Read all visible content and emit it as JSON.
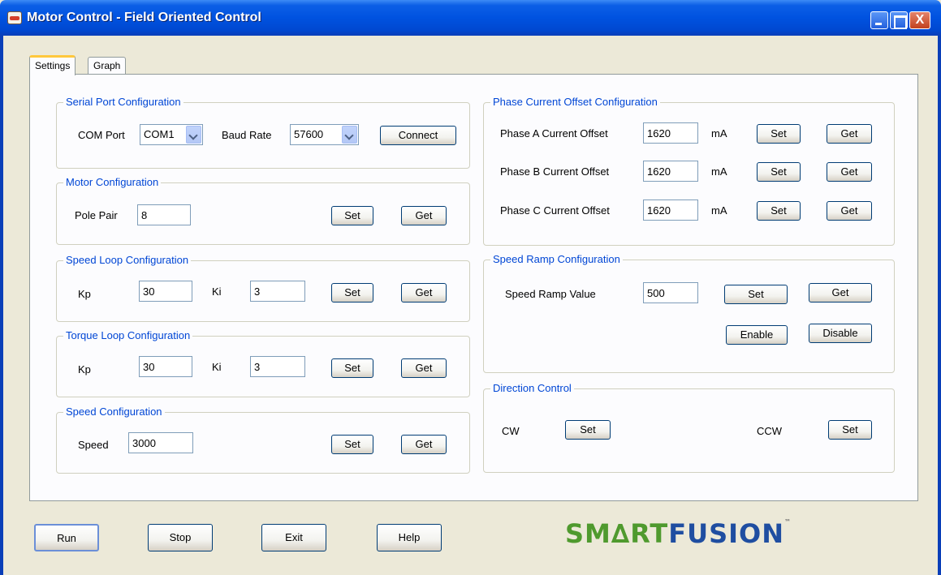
{
  "window": {
    "title": "Motor Control - Field Oriented Control",
    "close_glyph": "X"
  },
  "tabs": [
    {
      "label": "Settings"
    },
    {
      "label": "Graph"
    }
  ],
  "serial": {
    "title": "Serial Port Configuration",
    "com_label": "COM Port",
    "com_value": "COM1",
    "baud_label": "Baud Rate",
    "baud_value": "57600",
    "connect_label": "Connect"
  },
  "motor": {
    "title": "Motor Configuration",
    "pole_label": "Pole Pair",
    "pole_value": "8",
    "set_label": "Set",
    "get_label": "Get"
  },
  "speed_loop": {
    "title": "Speed Loop Configuration",
    "kp_label": "Kp",
    "kp_value": "30",
    "ki_label": "Ki",
    "ki_value": "3",
    "set_label": "Set",
    "get_label": "Get"
  },
  "torque_loop": {
    "title": "Torque Loop Configuration",
    "kp_label": "Kp",
    "kp_value": "30",
    "ki_label": "Ki",
    "ki_value": "3",
    "set_label": "Set",
    "get_label": "Get"
  },
  "speed_cfg": {
    "title": "Speed Configuration",
    "speed_label": "Speed",
    "speed_value": "3000",
    "set_label": "Set",
    "get_label": "Get"
  },
  "phase": {
    "title": "Phase Current Offset Configuration",
    "rows": [
      {
        "label": "Phase A Current Offset",
        "value": "1620",
        "unit": "mA",
        "set_label": "Set",
        "get_label": "Get"
      },
      {
        "label": "Phase B Current Offset",
        "value": "1620",
        "unit": "mA",
        "set_label": "Set",
        "get_label": "Get"
      },
      {
        "label": "Phase C Current Offset",
        "value": "1620",
        "unit": "mA",
        "set_label": "Set",
        "get_label": "Get"
      }
    ]
  },
  "ramp": {
    "title": "Speed Ramp Configuration",
    "label": "Speed Ramp Value",
    "value": "500",
    "set_label": "Set",
    "get_label": "Get",
    "enable_label": "Enable",
    "disable_label": "Disable"
  },
  "direction": {
    "title": "Direction Control",
    "cw_label": "CW",
    "cw_set": "Set",
    "ccw_label": "CCW",
    "ccw_set": "Set"
  },
  "bottom": {
    "run": "Run",
    "stop": "Stop",
    "exit": "Exit",
    "help": "Help"
  },
  "logo": {
    "smart": "SM∆RT",
    "fusion": "FUSION",
    "tm": "™"
  }
}
